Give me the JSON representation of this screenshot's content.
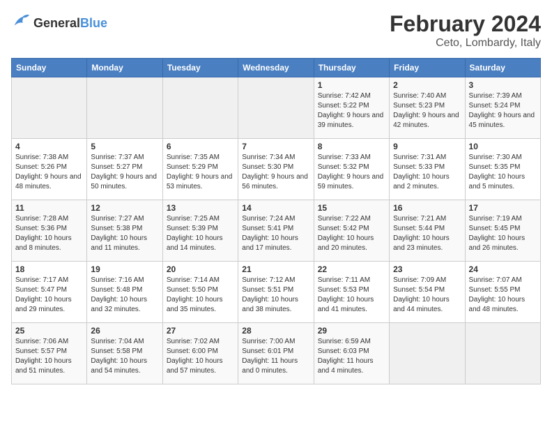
{
  "header": {
    "logo_general": "General",
    "logo_blue": "Blue",
    "main_title": "February 2024",
    "subtitle": "Ceto, Lombardy, Italy"
  },
  "calendar": {
    "days_of_week": [
      "Sunday",
      "Monday",
      "Tuesday",
      "Wednesday",
      "Thursday",
      "Friday",
      "Saturday"
    ],
    "weeks": [
      [
        {
          "day": "",
          "info": ""
        },
        {
          "day": "",
          "info": ""
        },
        {
          "day": "",
          "info": ""
        },
        {
          "day": "",
          "info": ""
        },
        {
          "day": "1",
          "info": "Sunrise: 7:42 AM\nSunset: 5:22 PM\nDaylight: 9 hours and 39 minutes."
        },
        {
          "day": "2",
          "info": "Sunrise: 7:40 AM\nSunset: 5:23 PM\nDaylight: 9 hours and 42 minutes."
        },
        {
          "day": "3",
          "info": "Sunrise: 7:39 AM\nSunset: 5:24 PM\nDaylight: 9 hours and 45 minutes."
        }
      ],
      [
        {
          "day": "4",
          "info": "Sunrise: 7:38 AM\nSunset: 5:26 PM\nDaylight: 9 hours and 48 minutes."
        },
        {
          "day": "5",
          "info": "Sunrise: 7:37 AM\nSunset: 5:27 PM\nDaylight: 9 hours and 50 minutes."
        },
        {
          "day": "6",
          "info": "Sunrise: 7:35 AM\nSunset: 5:29 PM\nDaylight: 9 hours and 53 minutes."
        },
        {
          "day": "7",
          "info": "Sunrise: 7:34 AM\nSunset: 5:30 PM\nDaylight: 9 hours and 56 minutes."
        },
        {
          "day": "8",
          "info": "Sunrise: 7:33 AM\nSunset: 5:32 PM\nDaylight: 9 hours and 59 minutes."
        },
        {
          "day": "9",
          "info": "Sunrise: 7:31 AM\nSunset: 5:33 PM\nDaylight: 10 hours and 2 minutes."
        },
        {
          "day": "10",
          "info": "Sunrise: 7:30 AM\nSunset: 5:35 PM\nDaylight: 10 hours and 5 minutes."
        }
      ],
      [
        {
          "day": "11",
          "info": "Sunrise: 7:28 AM\nSunset: 5:36 PM\nDaylight: 10 hours and 8 minutes."
        },
        {
          "day": "12",
          "info": "Sunrise: 7:27 AM\nSunset: 5:38 PM\nDaylight: 10 hours and 11 minutes."
        },
        {
          "day": "13",
          "info": "Sunrise: 7:25 AM\nSunset: 5:39 PM\nDaylight: 10 hours and 14 minutes."
        },
        {
          "day": "14",
          "info": "Sunrise: 7:24 AM\nSunset: 5:41 PM\nDaylight: 10 hours and 17 minutes."
        },
        {
          "day": "15",
          "info": "Sunrise: 7:22 AM\nSunset: 5:42 PM\nDaylight: 10 hours and 20 minutes."
        },
        {
          "day": "16",
          "info": "Sunrise: 7:21 AM\nSunset: 5:44 PM\nDaylight: 10 hours and 23 minutes."
        },
        {
          "day": "17",
          "info": "Sunrise: 7:19 AM\nSunset: 5:45 PM\nDaylight: 10 hours and 26 minutes."
        }
      ],
      [
        {
          "day": "18",
          "info": "Sunrise: 7:17 AM\nSunset: 5:47 PM\nDaylight: 10 hours and 29 minutes."
        },
        {
          "day": "19",
          "info": "Sunrise: 7:16 AM\nSunset: 5:48 PM\nDaylight: 10 hours and 32 minutes."
        },
        {
          "day": "20",
          "info": "Sunrise: 7:14 AM\nSunset: 5:50 PM\nDaylight: 10 hours and 35 minutes."
        },
        {
          "day": "21",
          "info": "Sunrise: 7:12 AM\nSunset: 5:51 PM\nDaylight: 10 hours and 38 minutes."
        },
        {
          "day": "22",
          "info": "Sunrise: 7:11 AM\nSunset: 5:53 PM\nDaylight: 10 hours and 41 minutes."
        },
        {
          "day": "23",
          "info": "Sunrise: 7:09 AM\nSunset: 5:54 PM\nDaylight: 10 hours and 44 minutes."
        },
        {
          "day": "24",
          "info": "Sunrise: 7:07 AM\nSunset: 5:55 PM\nDaylight: 10 hours and 48 minutes."
        }
      ],
      [
        {
          "day": "25",
          "info": "Sunrise: 7:06 AM\nSunset: 5:57 PM\nDaylight: 10 hours and 51 minutes."
        },
        {
          "day": "26",
          "info": "Sunrise: 7:04 AM\nSunset: 5:58 PM\nDaylight: 10 hours and 54 minutes."
        },
        {
          "day": "27",
          "info": "Sunrise: 7:02 AM\nSunset: 6:00 PM\nDaylight: 10 hours and 57 minutes."
        },
        {
          "day": "28",
          "info": "Sunrise: 7:00 AM\nSunset: 6:01 PM\nDaylight: 11 hours and 0 minutes."
        },
        {
          "day": "29",
          "info": "Sunrise: 6:59 AM\nSunset: 6:03 PM\nDaylight: 11 hours and 4 minutes."
        },
        {
          "day": "",
          "info": ""
        },
        {
          "day": "",
          "info": ""
        }
      ]
    ]
  }
}
